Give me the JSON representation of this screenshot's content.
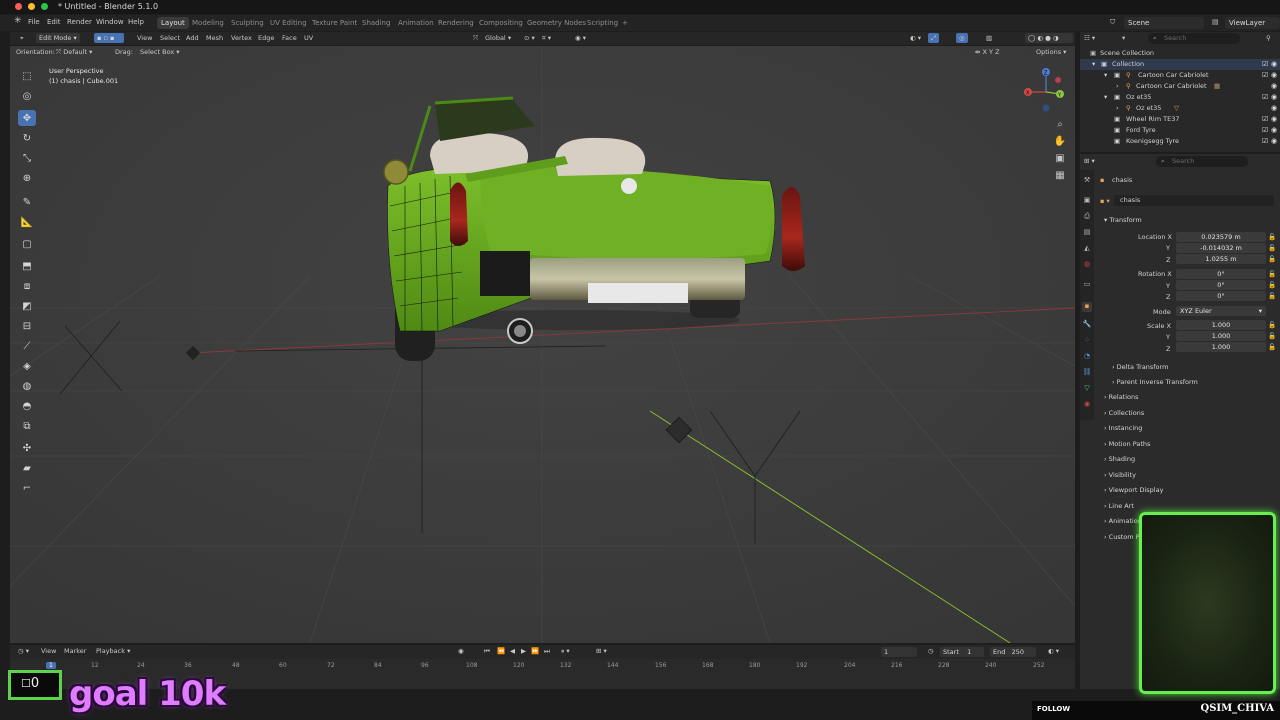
{
  "window": {
    "title": "* Untitled - Blender 5.1.0"
  },
  "topbar": {
    "menus": [
      "File",
      "Edit",
      "Render",
      "Window",
      "Help"
    ],
    "workspaces": [
      "Layout",
      "Modeling",
      "Sculpting",
      "UV Editing",
      "Texture Paint",
      "Shading",
      "Animation",
      "Rendering",
      "Compositing",
      "Geometry Nodes",
      "Scripting"
    ],
    "active_workspace": "Layout",
    "add_workspace": "+",
    "scene": "Scene",
    "view_layer": "ViewLayer"
  },
  "viewport_header": {
    "mode": "Edit Mode",
    "menus": [
      "View",
      "Select",
      "Add",
      "Mesh",
      "Vertex",
      "Edge",
      "Face",
      "UV"
    ],
    "transform_space": "Global",
    "options": "Options",
    "orientation_label": "Orientation:",
    "orientation_value": "Default",
    "drag_label": "Drag:",
    "drag_value": "Select Box"
  },
  "viewport": {
    "perspective": "User Perspective",
    "object_info": "(1) chasis | Cube.001",
    "gizmo_axes": [
      "X",
      "Y",
      "Z"
    ]
  },
  "timeline": {
    "menus": [
      "View",
      "Marker",
      "Playback"
    ],
    "current_frame": "1",
    "start_label": "Start",
    "start": "1",
    "end_label": "End",
    "end": "250",
    "ticks": [
      "1",
      "12",
      "24",
      "36",
      "48",
      "60",
      "72",
      "84",
      "96",
      "108",
      "120",
      "132",
      "144",
      "156",
      "168",
      "180",
      "192",
      "204",
      "216",
      "228",
      "240",
      "252"
    ]
  },
  "outliner": {
    "search_placeholder": "Search",
    "rows": [
      {
        "label": "Scene Collection",
        "indent": 0
      },
      {
        "label": "Collection",
        "indent": 1
      },
      {
        "label": "Cartoon Car Cabriolet",
        "indent": 2
      },
      {
        "label": "Cartoon Car Cabriolet",
        "indent": 3
      },
      {
        "label": "Oz et35",
        "indent": 2
      },
      {
        "label": "Oz et35",
        "indent": 3
      },
      {
        "label": "Wheel Rim TE37",
        "indent": 2
      },
      {
        "label": "Ford Tyre",
        "indent": 2
      },
      {
        "label": "Koenigsegg Tyre",
        "indent": 2
      }
    ]
  },
  "properties": {
    "search_placeholder": "Search",
    "object_name": "chasis",
    "object_field": "chasis",
    "transform_label": "Transform",
    "location_label": "Location X",
    "location": [
      "0.023579 m",
      "-0.014032 m",
      "1.0255 m"
    ],
    "rotation_label": "Rotation X",
    "rotation": [
      "0°",
      "0°",
      "0°"
    ],
    "mode_label": "Mode",
    "mode_value": "XYZ Euler",
    "scale_label": "Scale X",
    "scale": [
      "1.000",
      "1.000",
      "1.000"
    ],
    "axis_y": "Y",
    "axis_z": "Z",
    "sub_sections": [
      "Delta Transform",
      "Parent Inverse Transform"
    ],
    "sections": [
      "Relations",
      "Collections",
      "Instancing",
      "Motion Paths",
      "Shading",
      "Visibility",
      "Viewport Display",
      "Line Art",
      "Animation",
      "Custom Properties"
    ]
  },
  "overlay": {
    "counter": "0",
    "goal": "goal 10k",
    "follow": "FOLLOW",
    "channel": "QSIM_CHIVA"
  },
  "colors": {
    "accent": "#4772b3",
    "car_body": "#6aa51f",
    "overlay_green": "#67f04d",
    "goal_pink": "#e07cff"
  }
}
